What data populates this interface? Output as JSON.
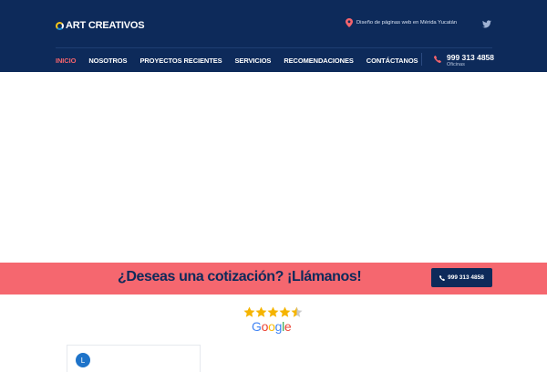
{
  "header": {
    "logo_text": "ART CREATIVOS",
    "location_text": "Diseño de páginas web en Mérida Yucatán",
    "phone_number": "999 313 4858",
    "phone_caption": "Oficinas"
  },
  "nav": {
    "items": [
      {
        "label": "INICIO",
        "active": true
      },
      {
        "label": "NOSOTROS",
        "active": false
      },
      {
        "label": "PROYECTOS RECIENTES",
        "active": false
      },
      {
        "label": "SERVICIOS",
        "active": false
      },
      {
        "label": "RECOMENDACIONES",
        "active": false
      },
      {
        "label": "CONTÁCTANOS",
        "active": false
      }
    ]
  },
  "cta": {
    "heading": "¿Deseas una cotización? ¡Llámanos!",
    "button_label": "999 313 4858"
  },
  "reviews": {
    "rating": 4.5,
    "rating_max": 5,
    "source": "Google",
    "first_card_avatar_letter": "L"
  },
  "colors": {
    "header_bg": "#0d2a5a",
    "accent": "#f5676f",
    "active_nav": "#f5646c",
    "star": "#f5b400"
  },
  "icons": {
    "location": "map-pin-icon",
    "social": "twitter-icon",
    "phone": "phone-icon"
  }
}
